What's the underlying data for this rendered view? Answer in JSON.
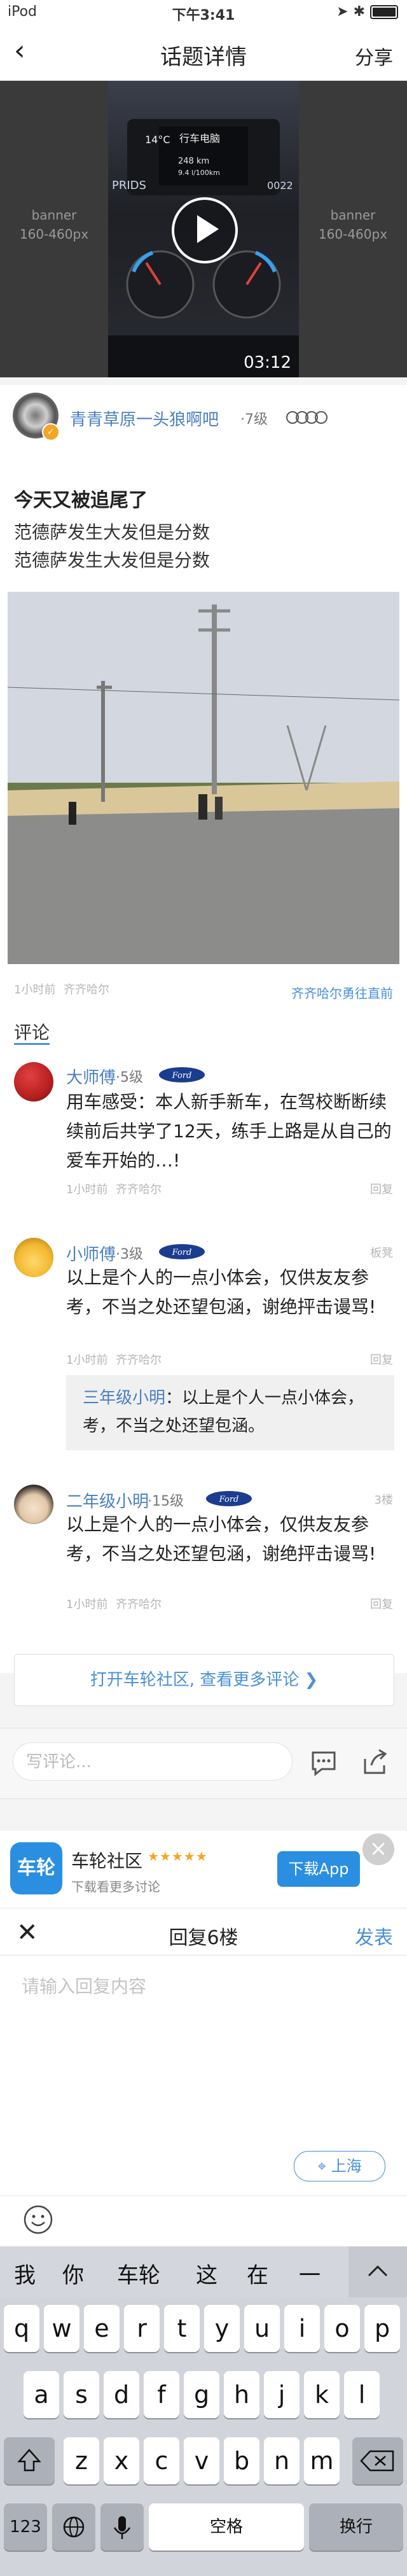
{
  "status_bar": {
    "carrier": "iPod",
    "time": "下午3:41"
  },
  "nav": {
    "title": "话题详情",
    "share": "分享",
    "back_icon": "chevron-left-icon"
  },
  "video": {
    "banner_left": {
      "line1": "banner",
      "line2": "160-460px"
    },
    "banner_right": {
      "line1": "banner",
      "line2": "160-460px"
    },
    "duration": "03:12",
    "dash_temp": "14°C",
    "dash_title": "行车电脑",
    "dash_distance": "248 km",
    "dash_consumption": "9.4 l/100km",
    "dash_brand": "PRIDS",
    "dash_odometer": "0022"
  },
  "post": {
    "author": "青青草原一头狼啊吧",
    "level": "·7级",
    "title": "今天又被追尾了",
    "body": [
      "范德萨发生大发但是分数",
      "范德萨发生大发但是分数"
    ],
    "time": "1小时前",
    "location": "齐齐哈尔",
    "tag": "齐齐哈尔勇往直前"
  },
  "comments": {
    "heading": "评论",
    "items": [
      {
        "name": "大师傅",
        "level": "·5级",
        "badge": "Ford",
        "text": "用车感受：本人新手新车，在驾校断断续续前后共学了12天，练手上路是从自己的爱车开始的…!",
        "time": "1小时前",
        "location": "齐齐哈尔",
        "reply": "回复",
        "floor": ""
      },
      {
        "name": "小师傅",
        "level": "·3级",
        "badge": "Ford",
        "text": "以上是个人的一点小体会，仅供友友参考，不当之处还望包涵，谢绝抨击谩骂!",
        "time": "1小时前",
        "location": "齐齐哈尔",
        "reply": "回复",
        "floor": "板凳",
        "quote_name": "三年级小明",
        "quote_text": "：以上是个人一点小体会，考，不当之处还望包涵。"
      },
      {
        "name": "二年级小明",
        "level": "·15级",
        "badge": "Ford",
        "text": "以上是个人的一点小体会，仅供友友参考，不当之处还望包涵，谢绝抨击谩骂!",
        "time": "1小时前",
        "location": "齐齐哈尔",
        "reply": "回复",
        "floor": "3楼"
      }
    ],
    "open_more": "打开车轮社区, 查看更多评论 ❯"
  },
  "comment_bar": {
    "placeholder": "写评论..."
  },
  "promo": {
    "app_name": "车轮社区",
    "stars": "★★★★★",
    "subtitle": "下载看更多讨论",
    "download": "下载App",
    "logo_text": "车轮"
  },
  "reply_panel": {
    "title": "回复6楼",
    "send": "发表",
    "placeholder": "请输入回复内容",
    "location": "上海"
  },
  "candidates": [
    "我",
    "你",
    "车轮",
    "这",
    "在",
    "一"
  ],
  "keyboard": {
    "row1": [
      "q",
      "w",
      "e",
      "r",
      "t",
      "y",
      "u",
      "i",
      "o",
      "p"
    ],
    "row2": [
      "a",
      "s",
      "d",
      "f",
      "g",
      "h",
      "j",
      "k",
      "l"
    ],
    "row3": [
      "z",
      "x",
      "c",
      "v",
      "b",
      "n",
      "m"
    ],
    "num": "123",
    "space": "空格",
    "enter": "换行"
  },
  "colors": {
    "accent": "#4a90d9",
    "username": "#4a7fc1",
    "download": "#2a8fe0"
  }
}
